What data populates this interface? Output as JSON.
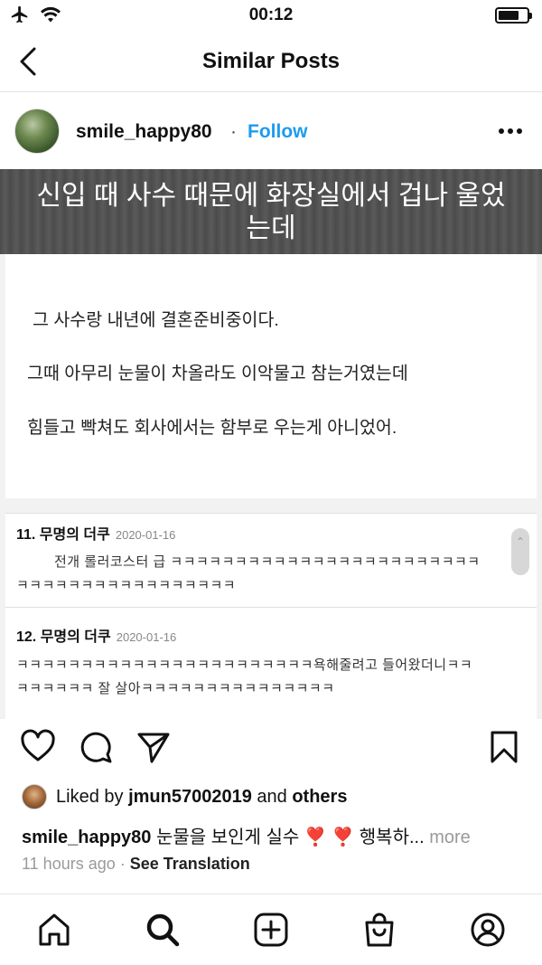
{
  "status_bar": {
    "time": "00:12",
    "battery_level": 0.6
  },
  "nav": {
    "title": "Similar Posts"
  },
  "post": {
    "username": "smile_happy80",
    "separator": "·",
    "follow_label": "Follow",
    "image_caption": "신입 때 사수 때문에 화장실에서 겁나 울었는데",
    "text_lines": [
      "그 사수랑 내년에 결혼준비중이다.",
      "그때 아무리 눈물이 차올라도 이악물고 참는거였는데",
      "힘들고 빡쳐도 회사에서는 함부로 우는게 아니었어."
    ],
    "comments": [
      {
        "header": "11. 무명의 더쿠",
        "date": "2020-01-16",
        "line1": "전개 롤러코스터 급 ㅋㅋㅋㅋㅋㅋㅋㅋㅋㅋㅋㅋㅋㅋㅋㅋㅋㅋㅋㅋㅋㅋㅋㅋ",
        "line2": "ㅋㅋㅋㅋㅋㅋㅋㅋㅋㅋㅋㅋㅋㅋㅋㅋㅋ"
      },
      {
        "header": "12. 무명의 더쿠",
        "date": "2020-01-16",
        "line1": "ㅋㅋㅋㅋㅋㅋㅋㅋㅋㅋㅋㅋㅋㅋㅋㅋㅋㅋㅋㅋㅋㅋㅋ욕해줄려고 들어왔더니ㅋㅋ",
        "line2": "ㅋㅋㅋㅋㅋㅋ 잘 살아ㅋㅋㅋㅋㅋㅋㅋㅋㅋㅋㅋㅋㅋㅋㅋ"
      }
    ],
    "liked_prefix": "Liked by",
    "liked_user": "jmun57002019",
    "liked_and": "and",
    "liked_others": "others",
    "caption_user": "smile_happy80",
    "caption_text": " 눈물을 보인게 실수 ❣️ ❣️ 행복하...",
    "caption_more": " more",
    "time_ago": "11 hours ago",
    "time_sep": " · ",
    "see_translation": "See Translation"
  },
  "icons": {
    "status": [
      "airplane-icon",
      "wifi-icon",
      "battery-icon"
    ],
    "actions": [
      "heart-icon",
      "comment-icon",
      "share-icon",
      "bookmark-icon"
    ],
    "tabs": [
      "home-icon",
      "search-icon",
      "add-post-icon",
      "shop-icon",
      "profile-icon"
    ]
  }
}
